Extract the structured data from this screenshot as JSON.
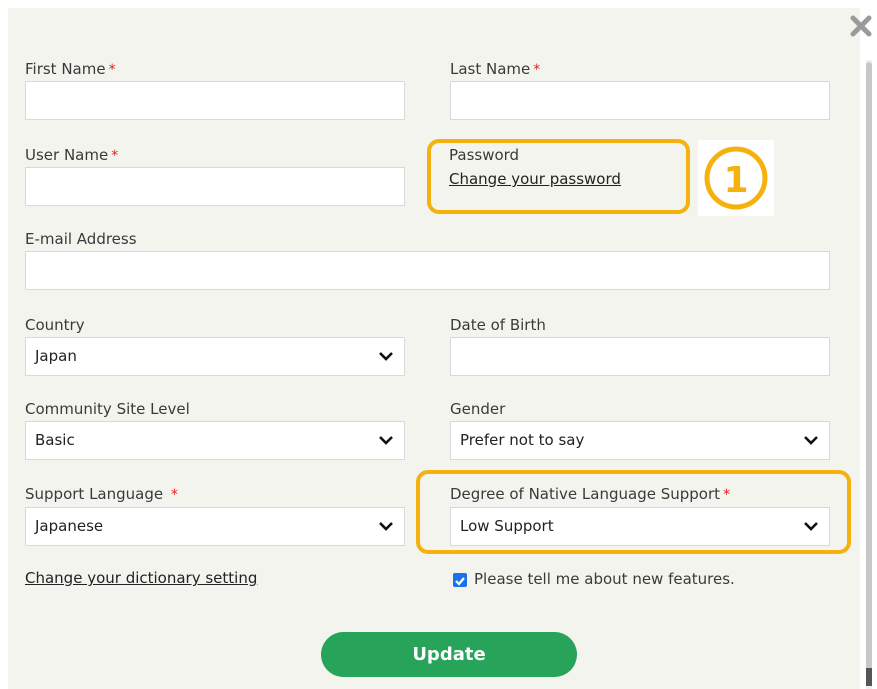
{
  "form": {
    "first_name": {
      "label": "First Name",
      "required_mark": "*",
      "value": ""
    },
    "last_name": {
      "label": "Last Name",
      "required_mark": "*",
      "value": ""
    },
    "user_name": {
      "label": "User Name",
      "required_mark": "*",
      "value": ""
    },
    "password": {
      "label": "Password",
      "change_link": "Change your password"
    },
    "email": {
      "label": "E-mail Address",
      "value": ""
    },
    "country": {
      "label": "Country",
      "selected": "Japan"
    },
    "date_of_birth": {
      "label": "Date of Birth",
      "value": ""
    },
    "community_site_level": {
      "label": "Community Site Level",
      "selected": "Basic"
    },
    "gender": {
      "label": "Gender",
      "selected": "Prefer not to say"
    },
    "support_language": {
      "label": "Support Language",
      "required_mark": "*",
      "selected": "Japanese"
    },
    "native_support": {
      "label": "Degree of Native Language Support",
      "required_mark": "*",
      "selected": "Low Support"
    },
    "dictionary_link": "Change your dictionary setting",
    "newsletter": {
      "label": "Please tell me about new features.",
      "checked": true
    },
    "update_label": "Update"
  },
  "annotation": {
    "marker": "①",
    "highlight_color": "#f5b20f"
  },
  "colors": {
    "required": "#e31d1d",
    "button": "#28a35a",
    "panel": "#f4f4ef"
  },
  "icons": {
    "close": "close-icon",
    "select_arrow": "chevron-down-icon",
    "check": "checkmark-icon"
  }
}
